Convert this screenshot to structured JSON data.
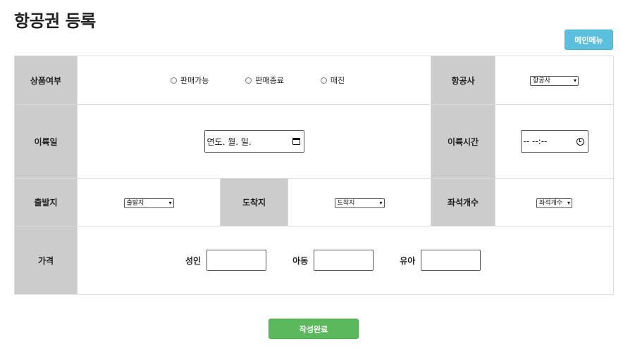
{
  "page": {
    "title": "항공권 등록",
    "main_menu_label": "메인메뉴",
    "submit_label": "작성완료"
  },
  "form": {
    "sale_status": {
      "label": "상품여부",
      "options": [
        "판매가능",
        "판매종료",
        "매진"
      ]
    },
    "airline": {
      "label": "항공사",
      "select_value": "항공사"
    },
    "departure_date": {
      "label": "이륙일",
      "value": "연도. 월. 일."
    },
    "departure_time": {
      "label": "이륙시간",
      "value": "-- --:--"
    },
    "origin": {
      "label": "출발지",
      "select_value": "출발지"
    },
    "destination": {
      "label": "도착지",
      "select_value": "도착지"
    },
    "seats": {
      "label": "좌석개수",
      "select_value": "좌석개수"
    },
    "price": {
      "label": "가격",
      "adult_label": "성인",
      "child_label": "아동",
      "infant_label": "유아"
    }
  }
}
